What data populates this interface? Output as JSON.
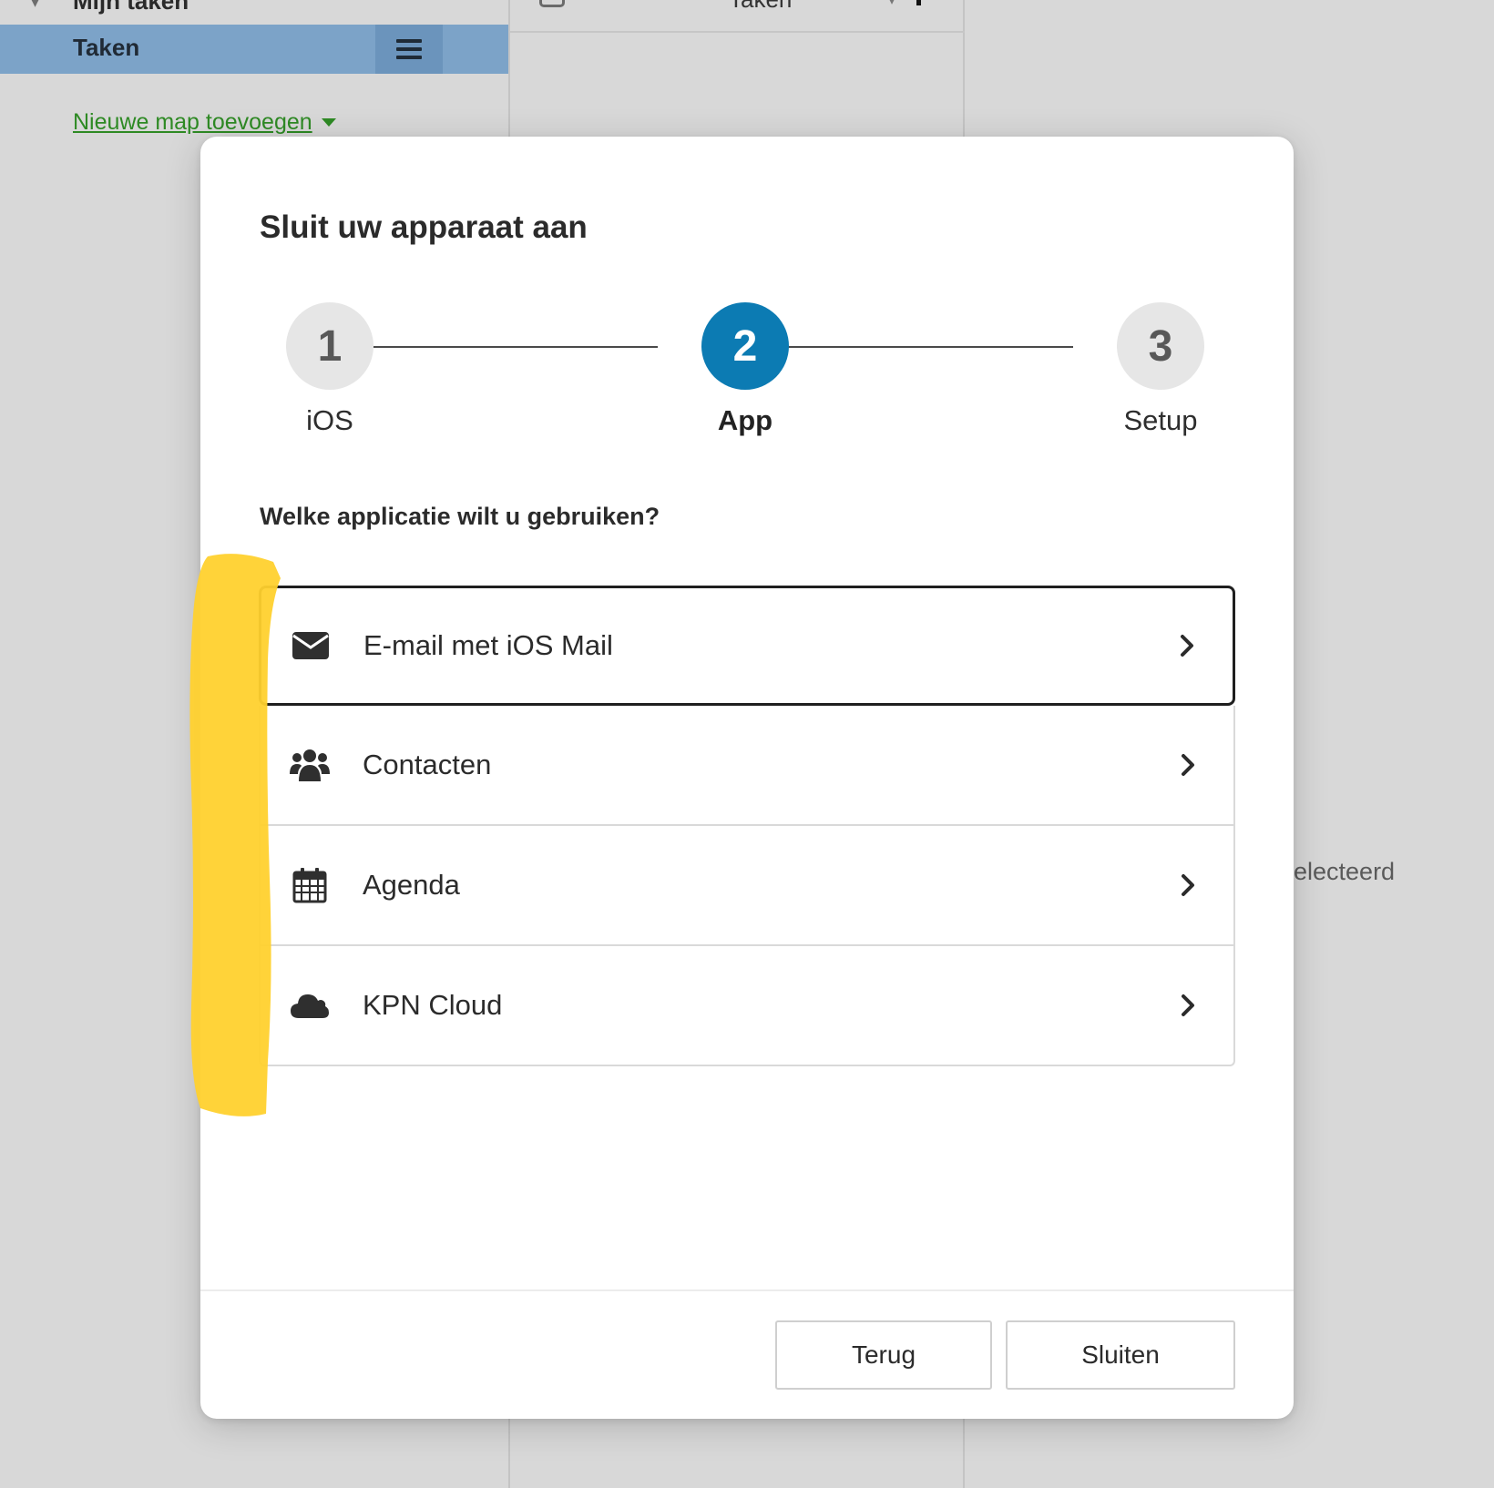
{
  "background": {
    "sidebar": {
      "partial_top_label": "Mijn taken",
      "selected_item_label": "Taken",
      "new_folder_link": "Nieuwe map toevoegen"
    },
    "list": {
      "partial_header_label": "Taken"
    },
    "detail": {
      "partial_status_text": "electeerd"
    }
  },
  "modal": {
    "title": "Sluit uw apparaat aan",
    "steps": [
      {
        "number": "1",
        "label": "iOS",
        "state": "done"
      },
      {
        "number": "2",
        "label": "App",
        "state": "active"
      },
      {
        "number": "3",
        "label": "Setup",
        "state": "upcoming"
      }
    ],
    "question": "Welke applicatie wilt u gebruiken?",
    "options": [
      {
        "label": "E-mail met iOS Mail",
        "icon": "envelope-icon",
        "focused": true
      },
      {
        "label": "Contacten",
        "icon": "users-icon",
        "focused": false
      },
      {
        "label": "Agenda",
        "icon": "calendar-icon",
        "focused": false
      },
      {
        "label": "KPN Cloud",
        "icon": "cloud-icon",
        "focused": false
      }
    ],
    "footer": {
      "back_label": "Terug",
      "close_label": "Sluiten"
    }
  },
  "colors": {
    "accent": "#0c7bb3",
    "sidebar_selected": "#7ca3c8",
    "link_green": "#2e8a24",
    "highlighter": "#ffd12e"
  }
}
